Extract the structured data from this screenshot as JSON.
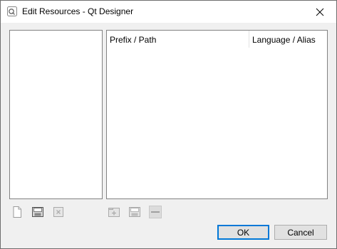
{
  "window": {
    "title": "Edit Resources - Qt Designer"
  },
  "icons": {
    "app": "qt-designer-icon",
    "close": "close-icon",
    "new_file": "new-file-icon",
    "open_file": "open-file-icon",
    "remove_file": "remove-file-icon",
    "add_prefix": "add-prefix-icon",
    "add_files": "add-files-icon",
    "remove": "remove-icon"
  },
  "resource_tree": {
    "columns": [
      "Prefix / Path",
      "Language / Alias"
    ]
  },
  "buttons": {
    "ok": "OK",
    "cancel": "Cancel"
  },
  "colors": {
    "accent": "#0078d7"
  }
}
